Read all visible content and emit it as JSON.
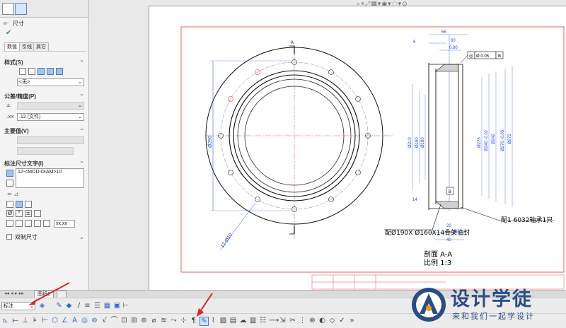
{
  "panel": {
    "title": "尺寸",
    "subtabs": [
      "数值",
      "引线",
      "其它"
    ],
    "style_header": "样式(S)",
    "style_value": "<无>",
    "tolerance_header": "公差/精度(P)",
    "precision_value": ".12 (文件)",
    "primary_value_header": "主要值(V)",
    "dim_text_header": "标注尺寸文字(I)",
    "dim_text_value": "12-<MOD-DIAM>10",
    "xx_label": "xx.xx",
    "dual_dim_label": "双制尺寸"
  },
  "sheet_tab": "图纸1",
  "layer": {
    "value": "标注"
  },
  "drawing": {
    "view_letter": "A",
    "left_dims": [
      "Ø290",
      "12-Ø10"
    ],
    "section_labels": [
      "剖面 A-A",
      "比例 1:3"
    ],
    "callout_oil_seal": "配Ø190X Ø160X14骨架油封",
    "callout_bearing": "配1 6032轴承1只",
    "tolerance_frame": [
      "◎",
      "Ø 0.05",
      "B"
    ],
    "datum_b": "B",
    "top_dims": [
      "66",
      "6",
      "60",
      "0.80"
    ],
    "vertical_dims": [
      "Ø210",
      "Ø190",
      "Ø180",
      "Ø225",
      "Ø240 -0.02",
      "Ø242",
      "Ø270 -0.05",
      "Ø272"
    ],
    "bottom_dims": [
      "14",
      "20",
      "0.10",
      "40"
    ]
  },
  "logo": {
    "title": "设计学徒",
    "subtitle": "来和我们一起学设计"
  },
  "colors": {
    "border": "#e13a3a",
    "arrow": "#e0202a",
    "dim": "#1f44ff",
    "logo": "#2a4d84"
  }
}
